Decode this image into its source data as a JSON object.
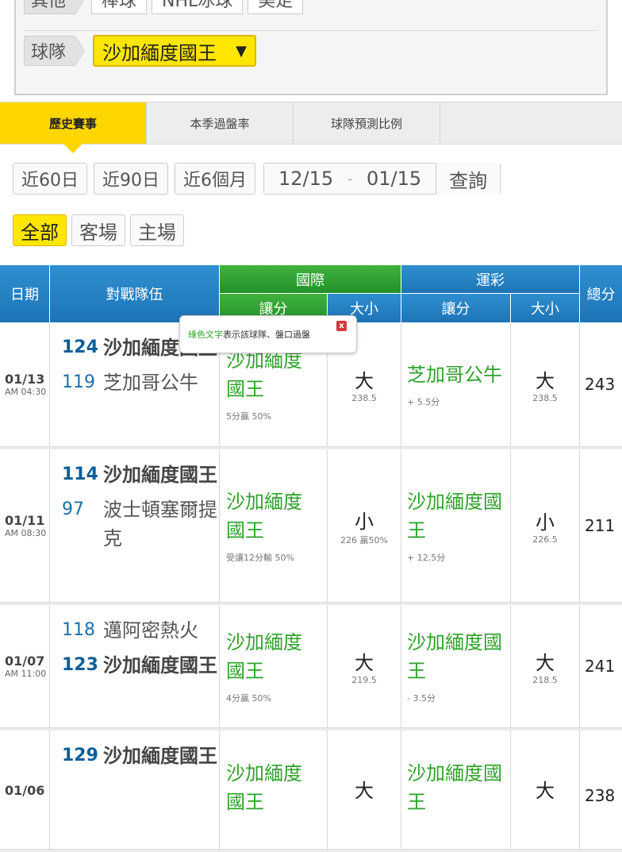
{
  "filters": {
    "row1": {
      "crumb": "其他",
      "chips": [
        "棒球",
        "NHL冰球",
        "美足"
      ]
    },
    "row2": {
      "crumb": "球隊",
      "selected_team": "沙加緬度國王"
    }
  },
  "tabs": [
    {
      "label": "歷史賽事",
      "active": true
    },
    {
      "label": "本季過盤率",
      "active": false
    },
    {
      "label": "球隊預測比例",
      "active": false
    }
  ],
  "range_buttons": [
    "近60日",
    "近90日",
    "近6個月"
  ],
  "date_from": "12/15",
  "date_sep": "-",
  "date_to": "01/15",
  "query_label": "查詢",
  "venue": [
    "全部",
    "客場",
    "主場"
  ],
  "table_header": {
    "date": "日期",
    "teams": "對戰隊伍",
    "intl": "國際",
    "intl_spread": "讓分",
    "intl_ou": "大小",
    "sportslottery": "運彩",
    "sl_spread": "讓分",
    "sl_ou": "大小",
    "total": "總分"
  },
  "tooltip": {
    "green_text": "綠色文字",
    "rest": "表示該球隊、盤口過盤",
    "close": "x"
  },
  "rows": [
    {
      "date": "01/13",
      "time": "AM 04:30",
      "team1_score": "124",
      "team1_name": "沙加緬度國王",
      "team2_score": "119",
      "team2_name": "芝加哥公牛",
      "intl_team": "沙加緬度國王",
      "intl_note": "5分贏 50%",
      "intl_ou": "大",
      "intl_ou_line": "238.5",
      "sl_team": "芝加哥公牛",
      "sl_note": "+ 5.5分",
      "sl_ou": "大",
      "sl_ou_line": "238.5",
      "total": "243"
    },
    {
      "date": "01/11",
      "time": "AM 08:30",
      "team1_score": "114",
      "team1_name": "沙加緬度國王",
      "team2_score": "97",
      "team2_name": "波士頓塞爾提克",
      "intl_team": "沙加緬度國王",
      "intl_note": "受讓12分輸 50%",
      "intl_ou": "小",
      "intl_ou_line": "226 贏50%",
      "sl_team": "沙加緬度國王",
      "sl_note": "+ 12.5分",
      "sl_ou": "小",
      "sl_ou_line": "226.5",
      "total": "211"
    },
    {
      "date": "01/07",
      "time": "AM 11:00",
      "team1_score": "118",
      "team1_name": "邁阿密熱火",
      "team2_score": "123",
      "team2_name": "沙加緬度國王",
      "intl_team": "沙加緬度國王",
      "intl_note": "4分贏 50%",
      "intl_ou": "大",
      "intl_ou_line": "219.5",
      "sl_team": "沙加緬度國王",
      "sl_note": "- 3.5分",
      "sl_ou": "大",
      "sl_ou_line": "218.5",
      "total": "241"
    },
    {
      "date": "01/06",
      "time": "",
      "team1_score": "129",
      "team1_name": "沙加緬度國王",
      "team2_score": "",
      "team2_name": "",
      "intl_team": "沙加緬度國王",
      "intl_note": "",
      "intl_ou": "大",
      "intl_ou_line": "",
      "sl_team": "沙加緬度國王",
      "sl_note": "",
      "sl_ou": "大",
      "sl_ou_line": "",
      "total": "238"
    }
  ]
}
